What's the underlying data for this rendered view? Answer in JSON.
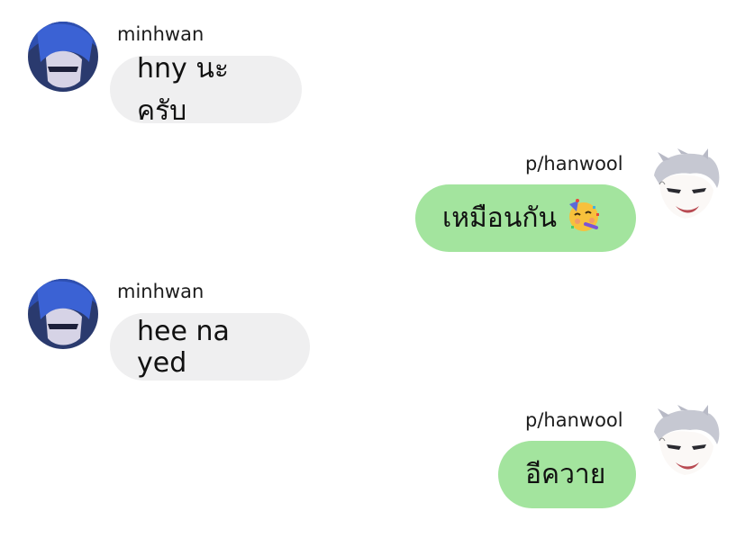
{
  "messages": [
    {
      "sender": "minhwan",
      "text": "hny นะครับ",
      "direction": "incoming"
    },
    {
      "sender": "p/hanwool",
      "text": "เหมือนกัน",
      "emoji": "partying-face-emoji",
      "direction": "outgoing"
    },
    {
      "sender": "minhwan",
      "text": "hee na yed",
      "direction": "incoming"
    },
    {
      "sender": "p/hanwool",
      "text": "อีควาย",
      "direction": "outgoing"
    }
  ],
  "colors": {
    "incoming_bubble": "#efeff0",
    "outgoing_bubble": "#a3e49e",
    "background": "#ffffff"
  }
}
